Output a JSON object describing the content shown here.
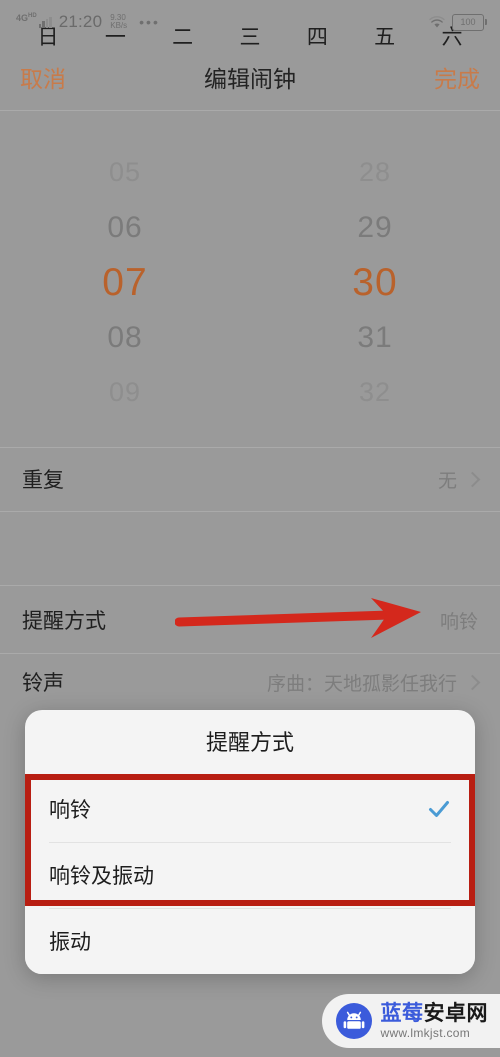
{
  "status_bar": {
    "network": "4G",
    "network_sup": "HD",
    "time": "21:20",
    "speed_value": "9.30",
    "speed_unit": "KB/s",
    "more_dots": "•••",
    "wifi_icon": "wifi-icon",
    "battery_level": "100"
  },
  "nav": {
    "cancel_label": "取消",
    "title": "编辑闹钟",
    "done_label": "完成",
    "accent_color": "#c87b4a"
  },
  "time_picker": {
    "hours": [
      "05",
      "06",
      "07",
      "08",
      "09"
    ],
    "minutes": [
      "28",
      "29",
      "30",
      "31",
      "32"
    ],
    "selected_hour": "07",
    "selected_minute": "30",
    "selected_color": "#b9622c"
  },
  "rows": {
    "repeat": {
      "label": "重复",
      "value": "无"
    },
    "weekdays": [
      "日",
      "一",
      "二",
      "三",
      "四",
      "五",
      "六"
    ],
    "remind": {
      "label": "提醒方式",
      "value": "响铃"
    },
    "ringtone": {
      "label": "铃声",
      "value": "序曲：天地孤影任我行"
    }
  },
  "annotations": {
    "arrow_color": "#d4281c",
    "box_color": "#b81e12",
    "arrow_name": "red-pointer-arrow",
    "box_name": "red-highlight-box"
  },
  "dialog": {
    "title": "提醒方式",
    "options": [
      {
        "label": "响铃",
        "checked": true
      },
      {
        "label": "响铃及振动",
        "checked": false
      },
      {
        "label": "振动",
        "checked": false
      }
    ],
    "check_color": "#4a9bd4"
  },
  "watermark": {
    "name_part1": "蓝莓",
    "name_part2": "安卓网",
    "url": "www.lmkjst.com",
    "icon": "android-robot-icon",
    "brand_color": "#3b5bdb"
  }
}
